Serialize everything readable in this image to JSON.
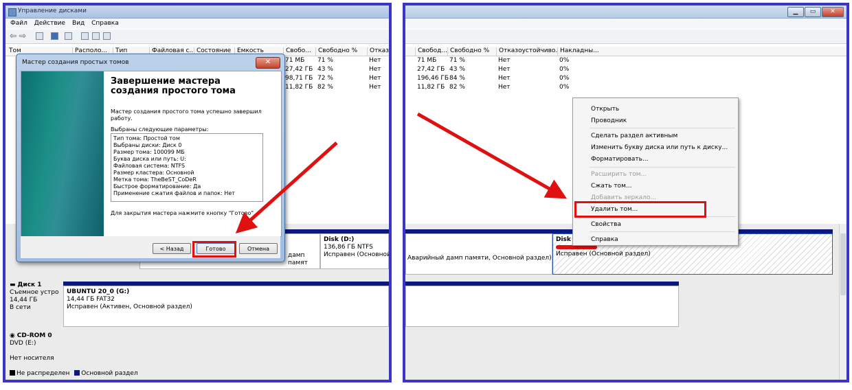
{
  "left": {
    "window_title": "Управление дисками",
    "menu": [
      "Файл",
      "Действие",
      "Вид",
      "Справка"
    ],
    "columns": [
      "Том",
      "Располо...",
      "Тип",
      "Файловая с...",
      "Состояние",
      "Емкость",
      "Свобо...",
      "Свободно %",
      "Отказо..."
    ],
    "rows": [
      {
        "free": "71 МБ",
        "free_pct": "71 %",
        "fault": "Нет"
      },
      {
        "free": "27,42 ГБ",
        "free_pct": "43 %",
        "fault": "Нет"
      },
      {
        "free": "98,71 ГБ",
        "free_pct": "72 %",
        "fault": "Нет"
      },
      {
        "free": "11,82 ГБ",
        "free_pct": "82 %",
        "fault": "Нет"
      }
    ],
    "disk_d": {
      "name": "Disk (D:)",
      "size": "136,86 ГБ NTFS",
      "status": "Исправен (Основной р"
    },
    "disk_d_left_fragment": "дамп памят",
    "disk1": {
      "label": "Диск 1",
      "type": "Съемное устро",
      "size": "14,44 ГБ",
      "state": "В сети"
    },
    "ubuntu": {
      "name": "UBUNTU 20_0  (G:)",
      "size": "14,44 ГБ FAT32",
      "status": "Исправен (Активен, Основной раздел)"
    },
    "cdrom": {
      "label": "CD-ROM 0",
      "drive": "DVD (E:)",
      "media": "Нет носителя"
    },
    "legend": [
      "Не распределен",
      "Основной раздел"
    ],
    "wizard": {
      "title": "Мастер создания простых томов",
      "close": "✕",
      "heading": "Завершение мастера создания простого тома",
      "success": "Мастер создания простого тома успешно завершил работу.",
      "params_label": "Выбраны следующие параметры:",
      "params": [
        "Тип тома: Простой том",
        "Выбраны диски: Диск 0",
        "Размер тома: 100099 МБ",
        "Буква диска или путь: U:",
        "Файловая система: NTFS",
        "Размер кластера: Основной",
        "Метка тома: TheBeST_CoDeR",
        "Быстрое форматирование: Да",
        "Применение сжатия файлов и папок: Нет"
      ],
      "close_hint": "Для закрытия мастера нажмите кнопку \"Готово\".",
      "btn_back": "< Назад",
      "btn_finish": "Готово",
      "btn_cancel": "Отмена"
    }
  },
  "right": {
    "columns": [
      "Свобод...",
      "Свободно %",
      "Отказоустойчиво...",
      "Накладны..."
    ],
    "rows": [
      {
        "free": "71 МБ",
        "free_pct": "71 %",
        "fault": "Нет",
        "overhead": "0%"
      },
      {
        "free": "27,42 ГБ",
        "free_pct": "43 %",
        "fault": "Нет",
        "overhead": "0%"
      },
      {
        "free": "196,46 ГБ",
        "free_pct": "84 %",
        "fault": "Нет",
        "overhead": "0%"
      },
      {
        "free": "11,82 ГБ",
        "free_pct": "82 %",
        "fault": "Нет",
        "overhead": "0%"
      }
    ],
    "crash_dump_status": "Аварийный дамп памяти, Основной раздел)",
    "disk_partial": {
      "name": "Disk",
      "status": "Исправен (Основной раздел)"
    },
    "context_menu": {
      "open": "Открыть",
      "explorer": "Проводник",
      "make_active": "Сделать раздел активным",
      "change_letter": "Изменить букву диска или путь к диску...",
      "format": "Форматировать...",
      "extend": "Расширить том...",
      "shrink": "Сжать том...",
      "mirror": "Добавить зеркало...",
      "delete": "Удалить том...",
      "properties": "Свойства",
      "help": "Справка"
    }
  },
  "colors": {
    "frame": "#3a35c4",
    "arrow": "#e01010",
    "volume_bar": "#0c1880"
  }
}
